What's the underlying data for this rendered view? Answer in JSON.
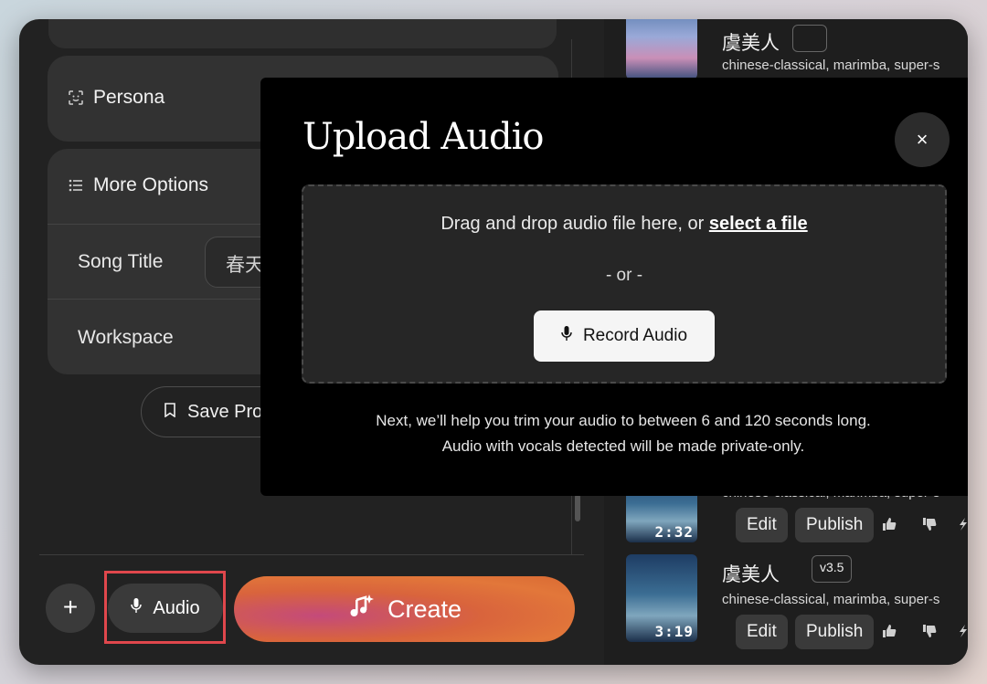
{
  "left": {
    "persona_label": "Persona",
    "more_options_label": "More Options",
    "song_title_label": "Song Title",
    "song_title_value": "春天",
    "workspace_label": "Workspace",
    "save_label": "Save Pro"
  },
  "bottom": {
    "plus_label": "+",
    "audio_label": "Audio",
    "create_label": "Create"
  },
  "songs": [
    {
      "title": "虞美人",
      "version": "",
      "tags": "chinese-classical, marimba, super-s",
      "duration": ""
    },
    {
      "title": "",
      "version": "",
      "tags": "chinese-classical, marimba, super-s",
      "duration": "2:32",
      "edit": "Edit",
      "publish": "Publish"
    },
    {
      "title": "虞美人",
      "version": "v3.5",
      "tags": "chinese-classical, marimba, super-s",
      "duration": "3:19",
      "edit": "Edit",
      "publish": "Publish"
    }
  ],
  "modal": {
    "title": "Upload Audio",
    "close": "×",
    "drop_prefix": "Drag and drop audio file here, or ",
    "drop_link": "select a file",
    "or": "- or -",
    "record_label": "Record Audio",
    "note_line1": "Next, we’ll help you trim your audio to between 6 and 120 seconds long.",
    "note_line2": "Audio with vocals detected will be made private-only."
  },
  "colors": {
    "accent_highlight": "#e0474c",
    "create_gradient_start": "#c44a7a",
    "create_gradient_end": "#e2773a"
  }
}
